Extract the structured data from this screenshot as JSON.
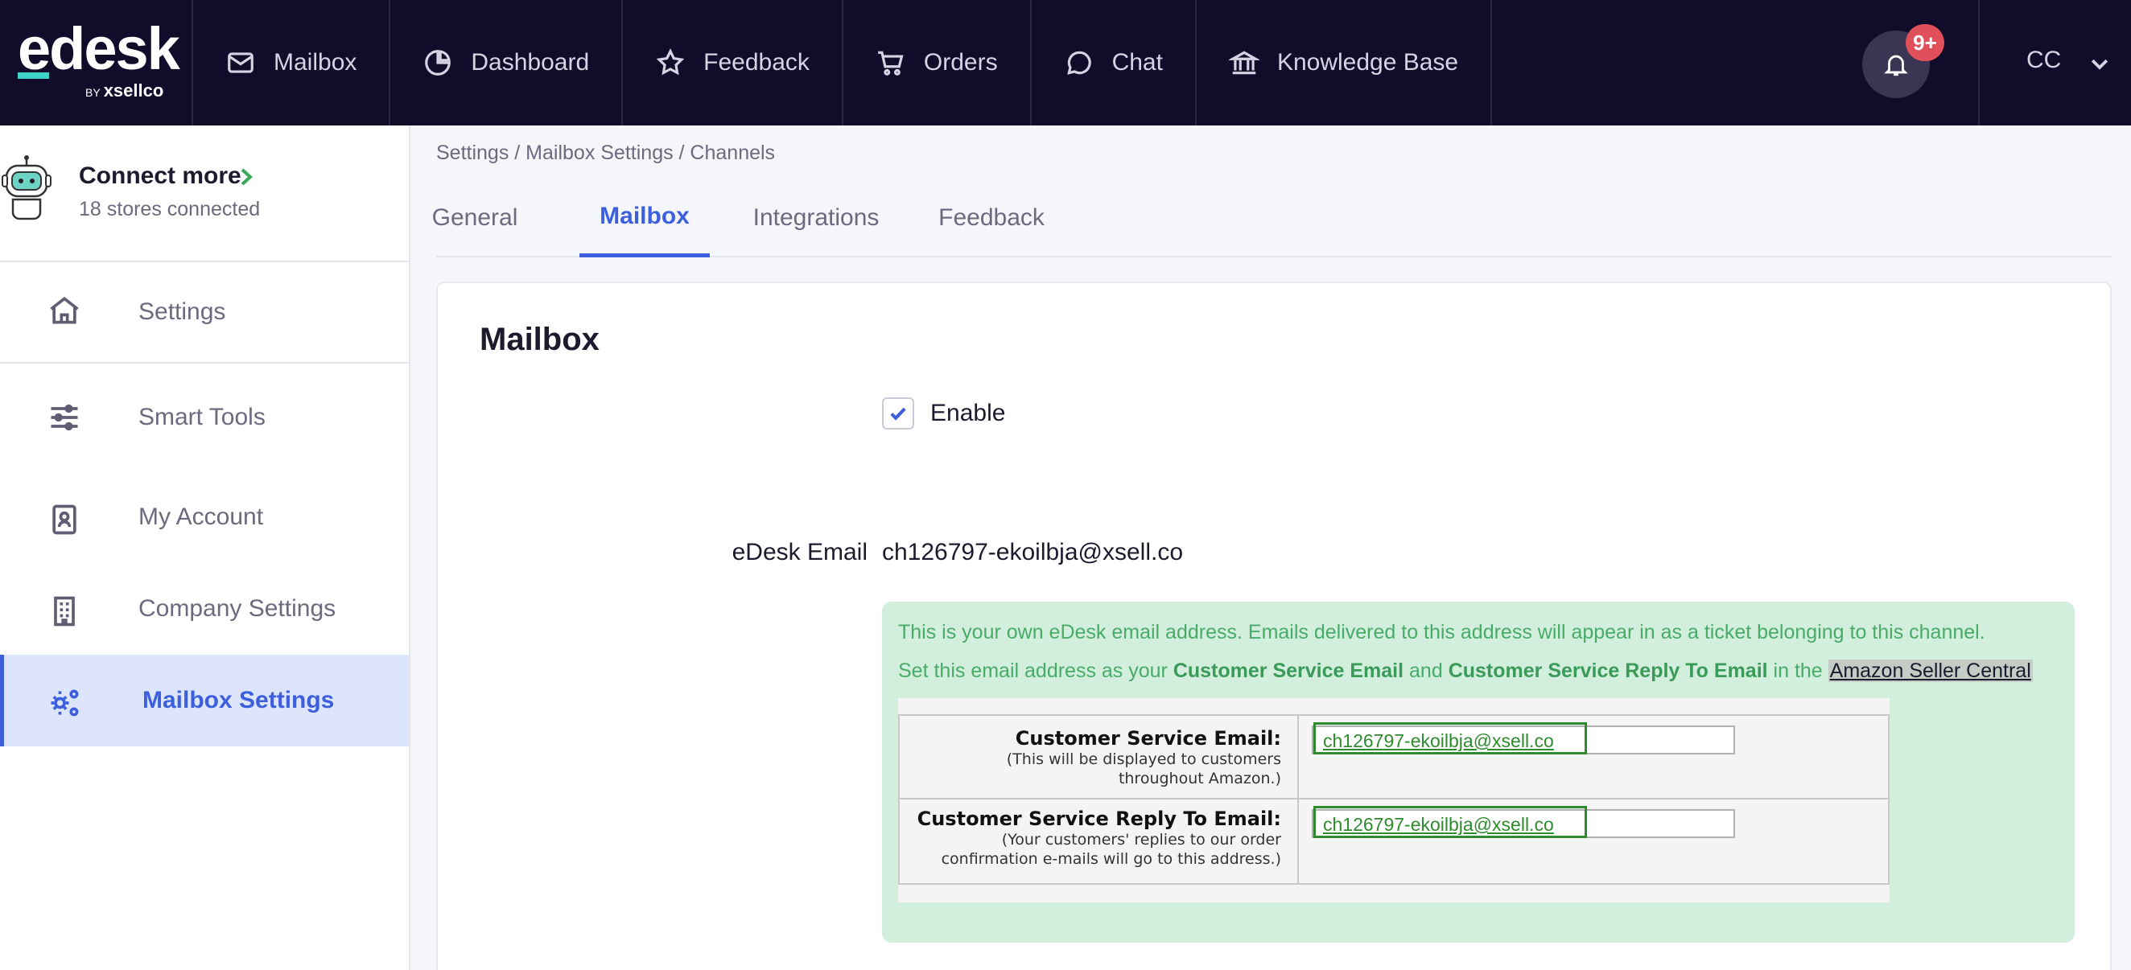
{
  "brand": {
    "name": "edesk",
    "sub_prefix": "BY",
    "sub_name": "xsellco"
  },
  "nav": [
    {
      "label": "Mailbox",
      "icon": "mail-icon"
    },
    {
      "label": "Dashboard",
      "icon": "pie-chart-icon"
    },
    {
      "label": "Feedback",
      "icon": "star-icon"
    },
    {
      "label": "Orders",
      "icon": "cart-icon"
    },
    {
      "label": "Chat",
      "icon": "chat-bubble-icon"
    },
    {
      "label": "Knowledge Base",
      "icon": "bank-icon"
    }
  ],
  "notifications": {
    "badge": "9+",
    "icon": "bell-icon"
  },
  "user": {
    "initials": "CC",
    "icon": "chevron-down-icon"
  },
  "sidebar": {
    "connect": {
      "title": "Connect more",
      "subtitle": "18 stores connected",
      "icon": "robot-icon"
    },
    "items": [
      {
        "label": "Settings",
        "icon": "home-icon"
      },
      {
        "label": "Smart Tools",
        "icon": "sliders-icon"
      },
      {
        "label": "My Account",
        "icon": "id-badge-icon"
      },
      {
        "label": "Company Settings",
        "icon": "building-icon"
      },
      {
        "label": "Mailbox Settings",
        "icon": "gears-icon",
        "active": true
      }
    ]
  },
  "breadcrumb": "Settings / Mailbox Settings / Channels",
  "tabs": [
    {
      "label": "General"
    },
    {
      "label": "Mailbox",
      "active": true
    },
    {
      "label": "Integrations"
    },
    {
      "label": "Feedback"
    }
  ],
  "card": {
    "title": "Mailbox",
    "enable_label": "Enable",
    "enable_checked": true,
    "email_label": "eDesk Email",
    "email_value": "ch126797-ekoilbja@xsell.co",
    "info": {
      "line1": "This is your own eDesk email address. Emails delivered to this address will appear in as a ticket belonging to this channel.",
      "line2_a": "Set this email address as your ",
      "line2_b": "Customer Service Email",
      "line2_c": " and ",
      "line2_d": "Customer Service Reply To Email",
      "line2_e": " in the ",
      "line2_link": "Amazon Seller Central"
    },
    "amazon": {
      "row1_label": "Customer Service Email:",
      "row1_sub1": "(This will be displayed to customers",
      "row1_sub2": "throughout Amazon.)",
      "row1_value": "ch126797-ekoilbja@xsell.co",
      "row2_label": "Customer Service Reply To Email:",
      "row2_sub1": "(Your customers' replies to our order",
      "row2_sub2": "confirmation e-mails will go to this address.)",
      "row2_value": "ch126797-ekoilbja@xsell.co"
    }
  },
  "colors": {
    "accent": "#3d5fde",
    "nav_bg": "#120c2b",
    "info_bg": "#d2eedd",
    "info_text": "#48ab68",
    "badge": "#e0505a"
  }
}
